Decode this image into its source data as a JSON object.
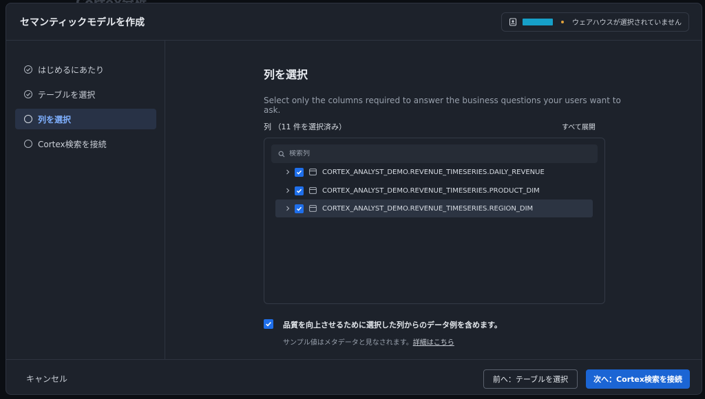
{
  "background_title": "Cortex分析",
  "header": {
    "title": "セマンティックモデルを作成",
    "warehouse_status": "ウェアハウスが選択されていません"
  },
  "sidebar": {
    "steps": [
      {
        "label": "はじめるにあたり",
        "state": "done"
      },
      {
        "label": "テーブルを選択",
        "state": "done"
      },
      {
        "label": "列を選択",
        "state": "active"
      },
      {
        "label": "Cortex検索を接続",
        "state": "pending"
      }
    ]
  },
  "main": {
    "title": "列を選択",
    "description": "Select only the columns required to answer the business questions your users want to ask.",
    "columns_label": "列 （11 件を選択済み）",
    "expand_all": "すべて展開",
    "search_placeholder": "検索列",
    "tables": [
      {
        "name": "CORTEX_ANALYST_DEMO.REVENUE_TIMESERIES.DAILY_REVENUE",
        "checked": true
      },
      {
        "name": "CORTEX_ANALYST_DEMO.REVENUE_TIMESERIES.PRODUCT_DIM",
        "checked": true
      },
      {
        "name": "CORTEX_ANALYST_DEMO.REVENUE_TIMESERIES.REGION_DIM",
        "checked": true
      }
    ],
    "include_sample": {
      "label": "品質を向上させるために選択した列からのデータ例を含めます。",
      "sub": "サンプル値はメタデータと見なされます。",
      "link": "詳細はこちら",
      "checked": true
    }
  },
  "footer": {
    "cancel": "キャンセル",
    "prev": "前へ：テーブルを選択",
    "next": "次へ：Cortex検索を接続"
  },
  "colors": {
    "accent": "#1b65d4",
    "checkbox": "#1f6feb",
    "warehouse_bar": "#16a0c8",
    "warning_dot": "#e1a23b"
  }
}
